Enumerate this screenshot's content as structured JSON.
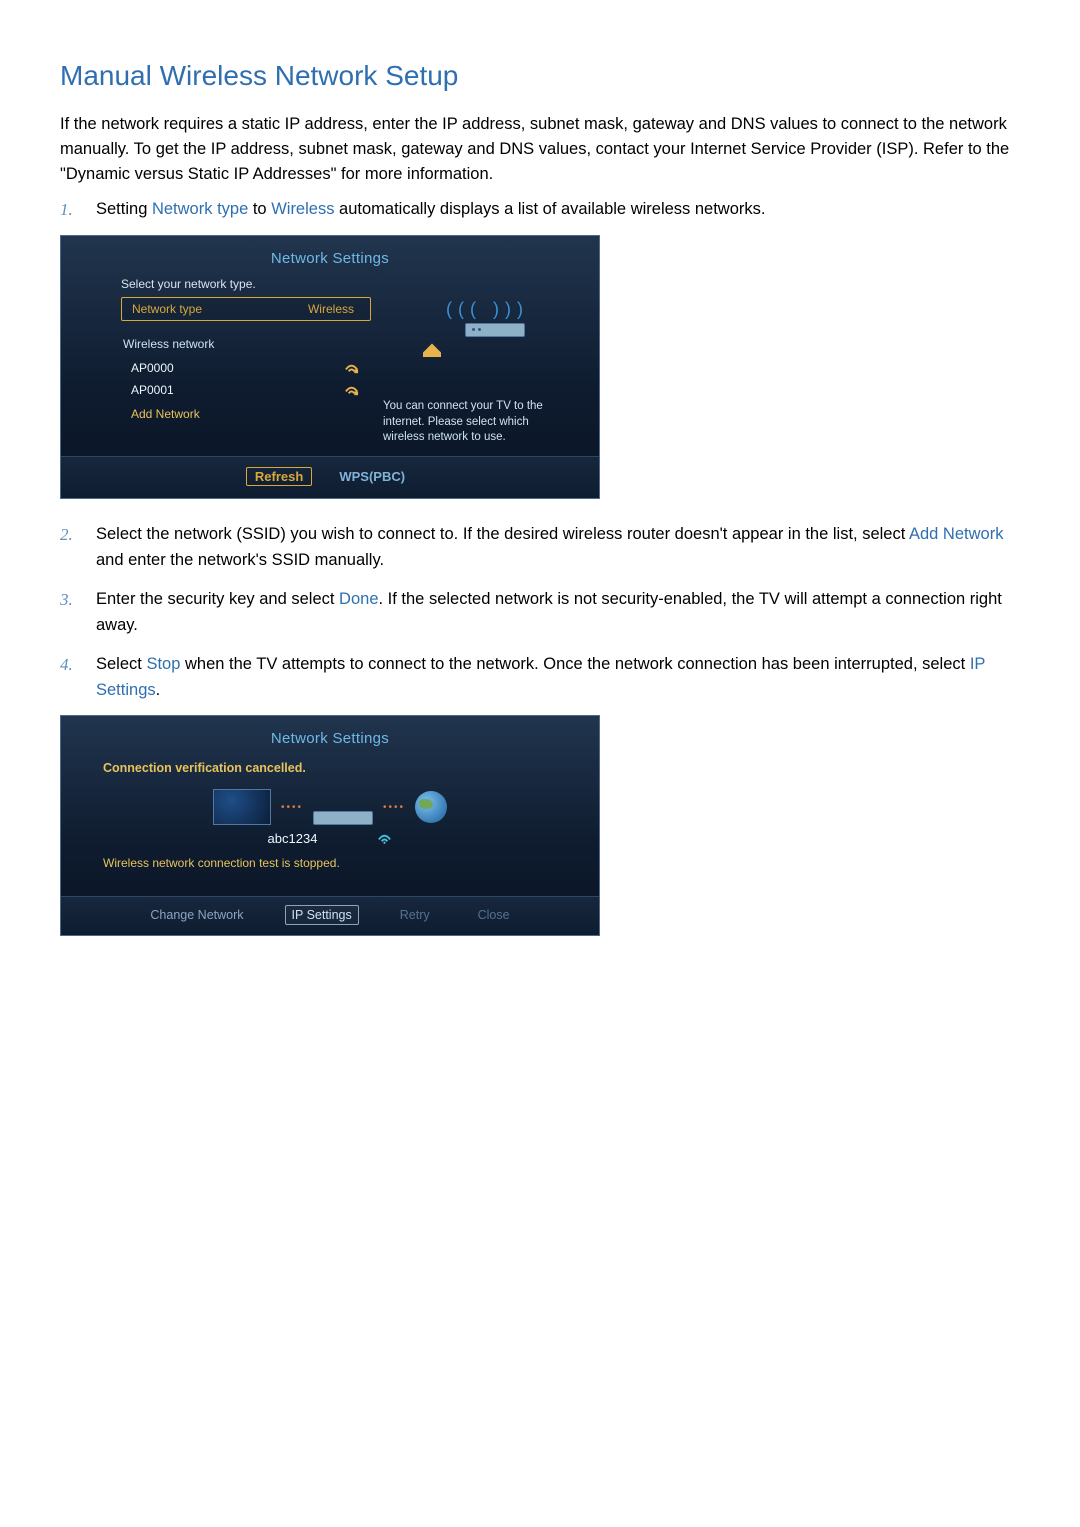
{
  "page": {
    "title": "Manual Wireless Network Setup",
    "intro": "If the network requires a static IP address, enter the IP address, subnet mask, gateway and DNS values to connect to the network manually. To get the IP address, subnet mask, gateway and DNS values, contact your Internet Service Provider (ISP). Refer to the \"Dynamic versus Static IP Addresses\" for more information."
  },
  "step1": {
    "num": "1.",
    "pre": "Setting ",
    "hl1": "Network type",
    "mid": " to ",
    "hl2": "Wireless",
    "post": " automatically displays a list of available wireless networks."
  },
  "panel1": {
    "title": "Network Settings",
    "sub": "Select your network type.",
    "row_label": "Network type",
    "row_value": "Wireless",
    "section": "Wireless network",
    "items": [
      "AP0000",
      "AP0001"
    ],
    "add": "Add Network",
    "help": "You can connect your TV to the internet. Please select which wireless network to use.",
    "footer": {
      "refresh": "Refresh",
      "wps": "WPS(PBC)"
    }
  },
  "step2": {
    "num": "2.",
    "pre": "Select the network (SSID) you wish to connect to. If the desired wireless router doesn't appear in the list, select ",
    "hl1": "Add Network",
    "post": " and enter the network's SSID manually."
  },
  "step3": {
    "num": "3.",
    "pre": "Enter the security key and select ",
    "hl1": "Done",
    "post": ". If the selected network is not security-enabled, the TV will attempt a connection right away."
  },
  "step4": {
    "num": "4.",
    "pre": "Select ",
    "hl1": "Stop",
    "mid": " when the TV attempts to connect to the network. Once the network connection has been interrupted, select ",
    "hl2": "IP Settings",
    "post": "."
  },
  "panel2": {
    "title": "Network Settings",
    "sub": "Connection verification cancelled.",
    "ssid": "abc1234",
    "stopped": "Wireless network connection test is stopped.",
    "footer": {
      "change": "Change Network",
      "ip": "IP Settings",
      "retry": "Retry",
      "close": "Close"
    }
  }
}
